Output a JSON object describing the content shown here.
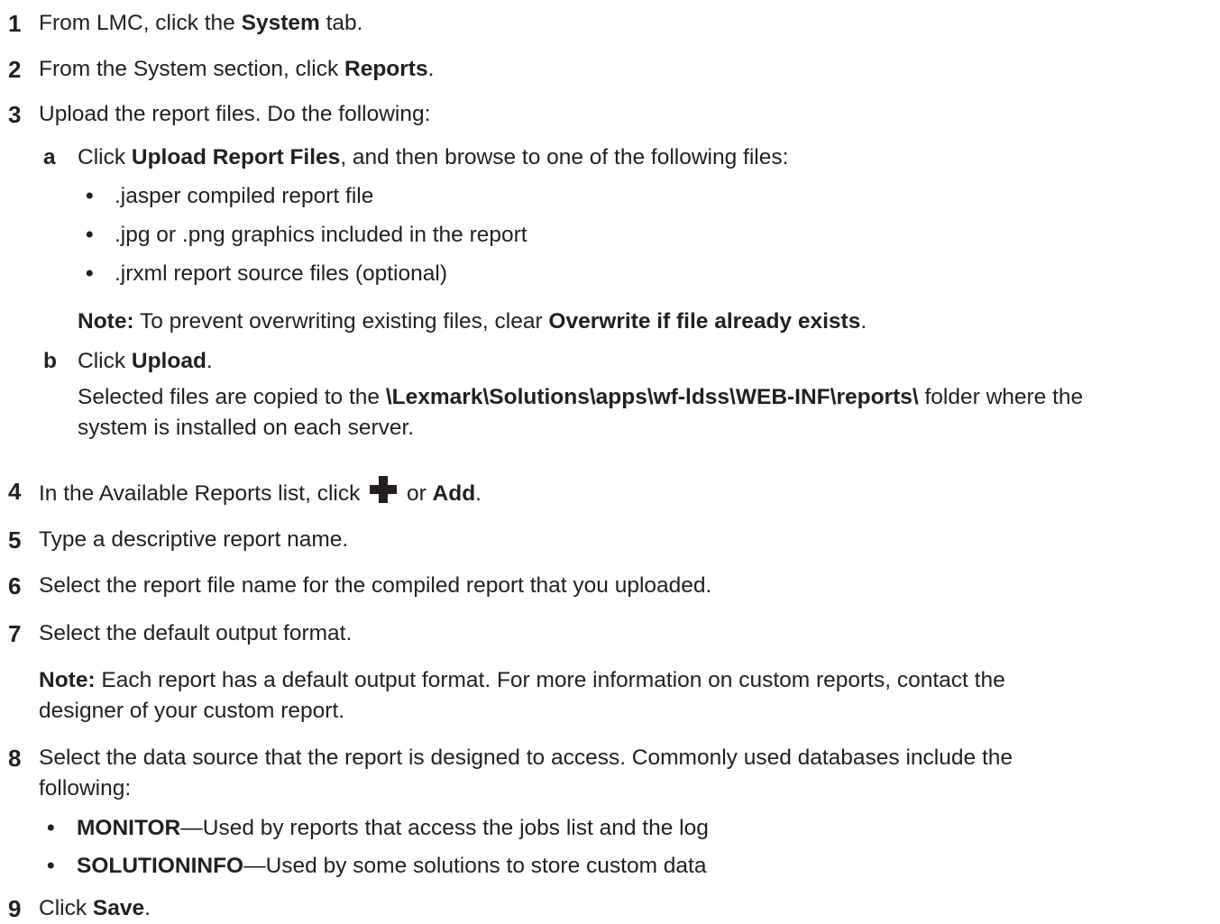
{
  "steps": {
    "s1": {
      "num": "1",
      "t1": "From LMC, click the ",
      "b1": "System",
      "t2": " tab."
    },
    "s2": {
      "num": "2",
      "t1": "From the System section, click ",
      "b1": "Reports",
      "t2": "."
    },
    "s3": {
      "num": "3",
      "t1": "Upload the report files. Do the following:",
      "a": {
        "label": "a",
        "t1": "Click ",
        "b1": "Upload Report Files",
        "t2": ", and then browse to one of the following files:",
        "bullets": [
          ".jasper compiled report file",
          ".jpg or .png graphics included in the report",
          ".jrxml report source files (optional)"
        ],
        "note": {
          "label": "Note:",
          "t1": " To prevent overwriting existing files, clear ",
          "b1": "Overwrite if file already exists",
          "t2": "."
        }
      },
      "b": {
        "label": "b",
        "t1": "Click ",
        "b1": "Upload",
        "t2": ".",
        "p1": "Selected files are copied to the ",
        "path": "\\Lexmark\\Solutions\\apps\\wf-ldss\\WEB-INF\\reports\\",
        "p2": " folder where the",
        "p3": "system is installed on each server."
      }
    },
    "s4": {
      "num": "4",
      "t1": "In the Available Reports list, click ",
      "icon": "plus-icon",
      "t2": " or ",
      "b1": "Add",
      "t3": "."
    },
    "s5": {
      "num": "5",
      "t1": "Type a descriptive report name."
    },
    "s6": {
      "num": "6",
      "t1": "Select the report file name for the compiled report that you uploaded."
    },
    "s7": {
      "num": "7",
      "t1": "Select the default output format.",
      "note": {
        "label": "Note:",
        "l1": " Each report has a default output format. For more information on custom reports, contact the",
        "l2": "designer of your custom report."
      }
    },
    "s8": {
      "num": "8",
      "l1": "Select the data source that the report is designed to access. Commonly used databases include the",
      "l2": "following:",
      "bullets": [
        {
          "b": "MONITOR",
          "t": "—Used by reports that access the jobs list and the log"
        },
        {
          "b": "SOLUTIONINFO",
          "t": "—Used by some solutions to store custom data"
        }
      ]
    },
    "s9": {
      "num": "9",
      "t1": "Click ",
      "b1": "Save",
      "t2": "."
    }
  }
}
